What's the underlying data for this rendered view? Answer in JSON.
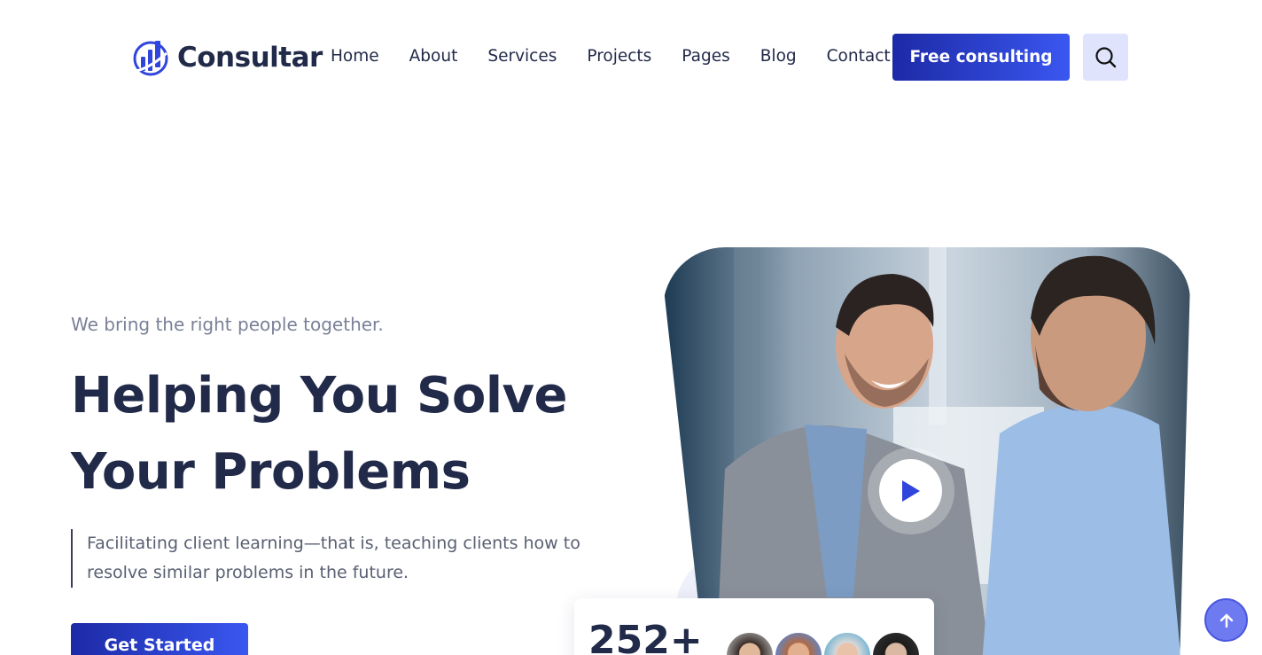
{
  "brand": {
    "name": "Consultar",
    "logo_icon": "bar-chart-logo-icon",
    "accent": "#2f45dc"
  },
  "nav": {
    "items": [
      {
        "label": "Home"
      },
      {
        "label": "About"
      },
      {
        "label": "Services"
      },
      {
        "label": "Projects"
      },
      {
        "label": "Pages"
      },
      {
        "label": "Blog"
      },
      {
        "label": "Contact"
      }
    ],
    "cta_label": "Free consulting",
    "search_icon": "search-icon"
  },
  "hero": {
    "tagline": "We bring the right people together.",
    "title_line1": "Helping You Solve",
    "title_line2": "Your Problems",
    "description": "Facilitating client learning—that is, teaching clients how to resolve similar problems in the future.",
    "button_label": "Get Started",
    "play_icon": "play-icon"
  },
  "stats": {
    "count": "252+"
  },
  "scroll_top_icon": "arrow-up-icon"
}
